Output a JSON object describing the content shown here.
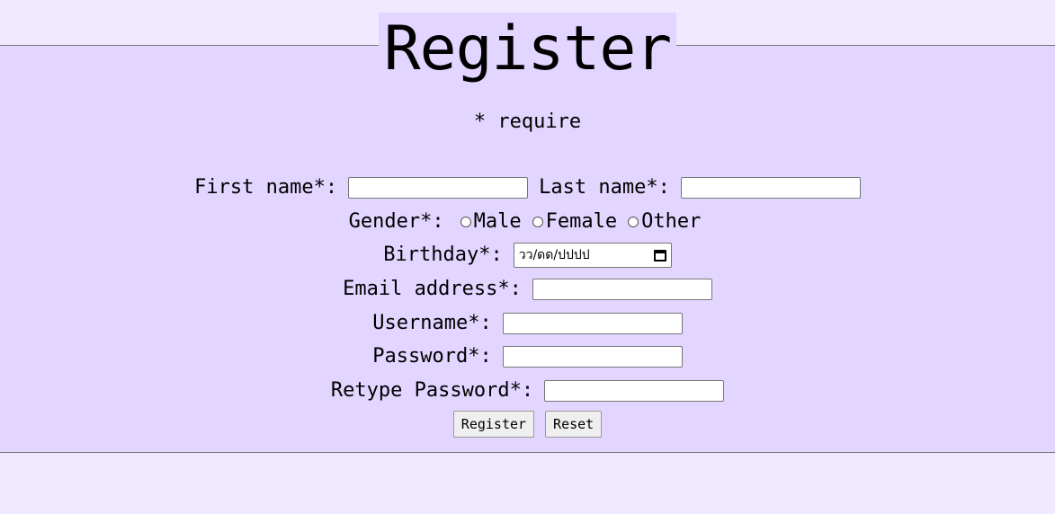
{
  "title": "Register",
  "require_note": "* require",
  "fields": {
    "first_name_label": "First name*:",
    "last_name_label": "Last name*:",
    "gender_label": "Gender*:",
    "gender_options": [
      "Male",
      "Female",
      "Other"
    ],
    "birthday_label": "Birthday*:",
    "birthday_placeholder": "วว/ดด/ปปปป",
    "email_label": "Email address*:",
    "username_label": "Username*:",
    "password_label": "Password*:",
    "retype_password_label": "Retype Password*:"
  },
  "buttons": {
    "register": "Register",
    "reset": "Reset"
  }
}
